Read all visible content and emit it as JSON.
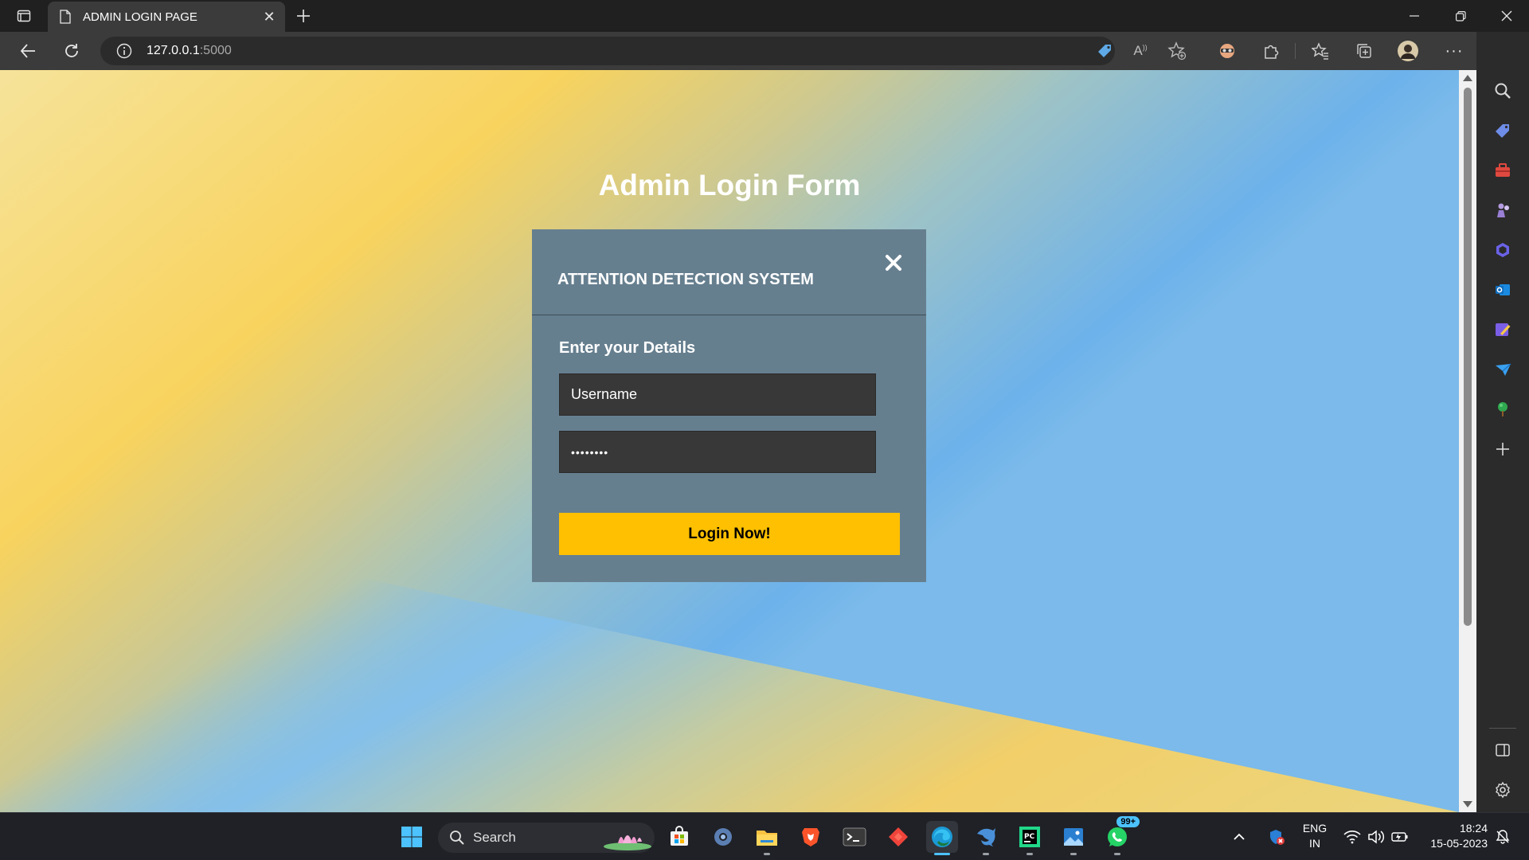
{
  "browser": {
    "tab_title": "ADMIN LOGIN PAGE",
    "url_host": "127.0.0.1",
    "url_port": ":5000"
  },
  "page": {
    "title": "Admin Login Form",
    "card_heading": "ATTENTION DETECTION SYSTEM",
    "details_label": "Enter your Details",
    "username_value": "Username",
    "password_value": "••••••••",
    "login_button": "Login Now!"
  },
  "taskbar": {
    "search_label": "Search",
    "whatsapp_badge": "99+",
    "language": "ENG",
    "region": "IN",
    "time": "18:24",
    "date": "15-05-2023"
  },
  "colors": {
    "card_bg": "#667f8f",
    "button_bg": "#fec000",
    "field_bg": "#383838"
  }
}
